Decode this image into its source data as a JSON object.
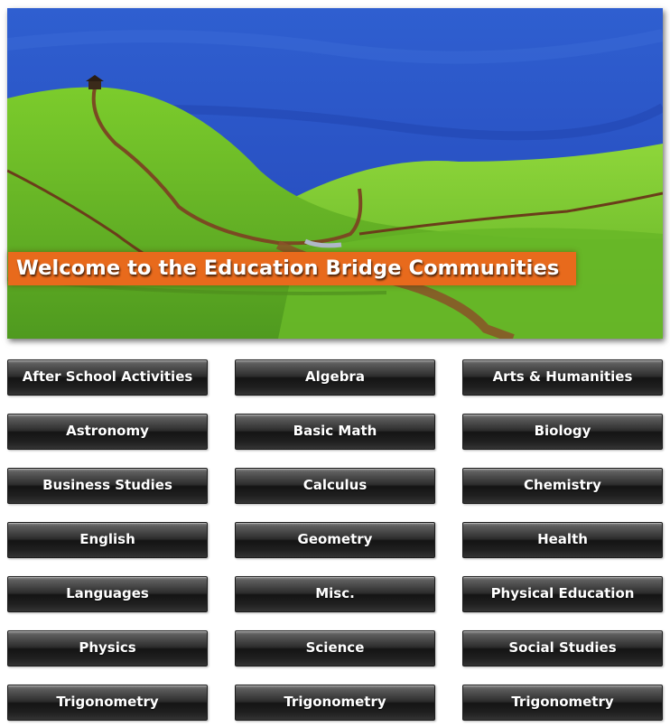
{
  "banner": {
    "title": "Welcome to the Education Bridge Communities"
  },
  "colors": {
    "sky": "#2b53c4",
    "hills": "#6fbf2a",
    "banner": "#e86a1c",
    "button_dark": "#1a1a1a"
  },
  "buttons": [
    [
      "After School Activities",
      "Algebra",
      "Arts & Humanities"
    ],
    [
      "Astronomy",
      "Basic Math",
      "Biology"
    ],
    [
      "Business Studies",
      "Calculus",
      "Chemistry"
    ],
    [
      "English",
      "Geometry",
      "Health"
    ],
    [
      "Languages",
      "Misc.",
      "Physical Education"
    ],
    [
      "Physics",
      "Science",
      "Social Studies"
    ],
    [
      "Trigonometry",
      "Trigonometry",
      "Trigonometry"
    ]
  ]
}
